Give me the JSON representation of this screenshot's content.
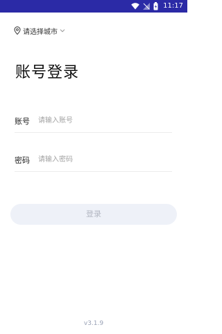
{
  "status_bar": {
    "time": "11:17",
    "icons": [
      "wifi-icon",
      "signal-icon",
      "battery-icon"
    ],
    "background": "#2b2aa6"
  },
  "city_selector": {
    "label": "请选择城市",
    "icon": "location-pin-icon"
  },
  "title": "账号登录",
  "form": {
    "account": {
      "label": "账号",
      "placeholder": "请输入账号"
    },
    "password": {
      "label": "密码",
      "placeholder": "请输入密码"
    }
  },
  "login_button": {
    "label": "登录"
  },
  "version": "v3.1.9"
}
